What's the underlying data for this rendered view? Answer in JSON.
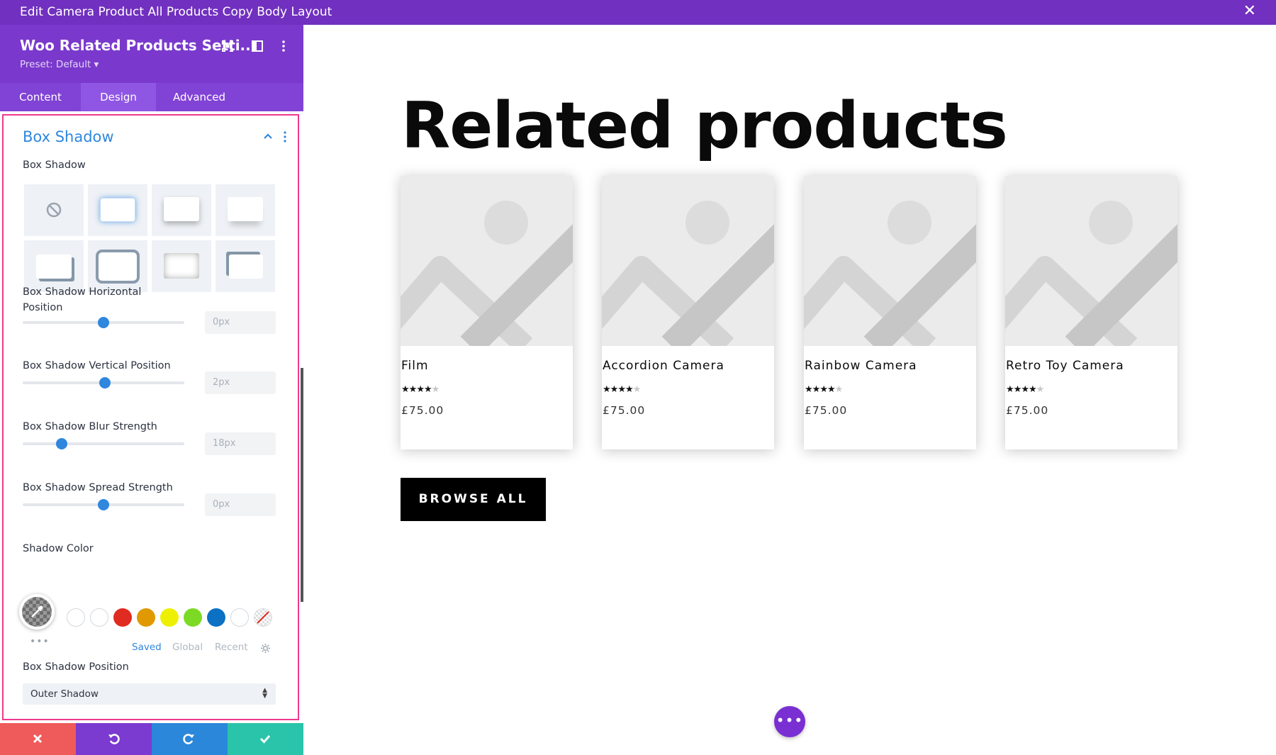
{
  "window": {
    "title": "Edit Camera Product All Products Copy Body Layout"
  },
  "panel": {
    "title": "Woo Related Products Setti...",
    "preset": "Preset: Default ▾",
    "tabs": [
      {
        "label": "Content"
      },
      {
        "label": "Design"
      },
      {
        "label": "Advanced"
      }
    ],
    "active_tab": "Design"
  },
  "section": {
    "title": "Box Shadow",
    "box_shadow_label": "Box Shadow",
    "presets_count": 8,
    "selected_preset": 1,
    "fields": [
      {
        "label": "Box Shadow Horizontal Position",
        "value": "0px",
        "level": 0.5
      },
      {
        "label": "Box Shadow Vertical Position",
        "value": "2px",
        "level": 0.51
      },
      {
        "label": "Box Shadow Blur Strength",
        "value": "18px",
        "level": 0.24
      },
      {
        "label": "Box Shadow Spread Strength",
        "value": "0px",
        "level": 0.5
      }
    ],
    "shadow_color": {
      "label": "Shadow Color",
      "swatches": [
        "#ffffff",
        "#ffffff",
        "#e02b20",
        "#e09900",
        "#edf000",
        "#7cda24",
        "#0c71c3",
        "#ffffff",
        "none"
      ],
      "tabs": [
        {
          "label": "Saved"
        },
        {
          "label": "Global"
        },
        {
          "label": "Recent"
        }
      ],
      "active_tab": "Saved"
    },
    "position": {
      "label": "Box Shadow Position",
      "value": "Outer Shadow"
    }
  },
  "colors": {
    "accent": "#2f87de",
    "purple": "#7130bf",
    "highlight": "#f0388f",
    "cancel": "#ef5a5a",
    "undo": "#7b3ad0",
    "redo": "#2b87da",
    "save": "#29c4a9"
  },
  "canvas": {
    "heading": "Related products",
    "products": [
      {
        "name": "Film",
        "price": "£75.00",
        "rating": 4
      },
      {
        "name": "Accordion Camera",
        "price": "£75.00",
        "rating": 4
      },
      {
        "name": "Rainbow Camera",
        "price": "£75.00",
        "rating": 4
      },
      {
        "name": "Retro Toy Camera",
        "price": "£75.00",
        "rating": 4
      }
    ],
    "browse_label": "BROWSE ALL",
    "fab_label": "•••"
  }
}
